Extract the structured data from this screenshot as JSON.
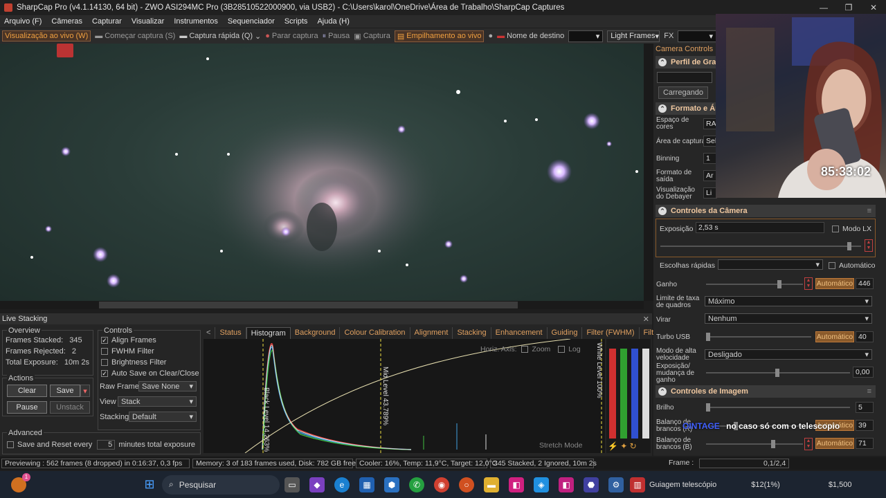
{
  "window": {
    "title": "SharpCap Pro (v4.1.14130, 64 bit) - ZWO ASI294MC Pro (3B28510522000900, via USB2) - C:\\Users\\karol\\OneDrive\\Área de Trabalho\\SharpCap Captures"
  },
  "menu": [
    "Arquivo (F)",
    "Câmeras",
    "Capturar",
    "Visualizar",
    "Instrumentos",
    "Sequenciador",
    "Scripts",
    "Ajuda (H)"
  ],
  "toolbar": {
    "live_view": "Visualização ao vivo (W)",
    "start_capture": "Começar captura (S)",
    "quick_capture": "Captura rápida (Q)",
    "stop_capture": "Parar captura",
    "pause": "Pausa",
    "capture": "Captura",
    "live_stack": "Empilhamento ao vivo",
    "target_label": "Nome de destino",
    "target_value": "",
    "frame_type": "Light Frames",
    "fx_label": "FX",
    "fx_value": ""
  },
  "live_stacking": {
    "title": "Live Stacking",
    "overview": {
      "title": "Overview",
      "frames_stacked_label": "Frames Stacked:",
      "frames_stacked": "345",
      "frames_rejected_label": "Frames Rejected:",
      "frames_rejected": "2",
      "total_exposure_label": "Total Exposure:",
      "total_exposure": "10m 2s"
    },
    "actions": {
      "title": "Actions",
      "clear": "Clear",
      "save": "Save",
      "pause": "Pause",
      "unstack": "Unstack"
    },
    "advanced": {
      "title": "Advanced",
      "save_reset_label": "Save and Reset every",
      "save_reset_value": "5",
      "save_reset_suffix": "minutes total exposure"
    },
    "controls": {
      "title": "Controls",
      "align_frames": "Align Frames",
      "fwhm_filter": "FWHM Filter",
      "brightness_filter": "Brightness Filter",
      "auto_save": "Auto Save on Clear/Close",
      "raw_frames_label": "Raw Frames",
      "raw_frames_value": "Save None",
      "view_label": "View",
      "view_value": "Stack",
      "stacking_label": "Stacking",
      "stacking_value": "Default"
    },
    "tabs": [
      "<",
      "Status",
      "Histogram",
      "Background",
      "Colour Calibration",
      "Alignment",
      "Stacking",
      "Enhancement",
      "Guiding",
      "Filter (FWHM)",
      "Filter (Brightness)",
      "F"
    ],
    "active_tab": "Histogram",
    "histogram": {
      "horiz_axis": "Horiz. Axis:",
      "zoom": "Zoom",
      "log": "Log",
      "black_level": "Black Level 14.263%",
      "mid_level": "Mid Level 43.789%",
      "white_level": "White Level 100%",
      "stretch_mode": "Stretch Mode"
    }
  },
  "status_bar": {
    "previewing": "Previewing : 562 frames (8 dropped) in 0:16:37, 0,3 fps",
    "memory": "Memory: 3 of 183 frames used, Disk: 782 GB free",
    "cooler": "Cooler: 16%, Temp: 11,9°C, Target: 12,0°C",
    "stacked": "345 Stacked, 2 Ignored, 10m 2s",
    "frame_label": "Frame :",
    "frame_value": "0,1/2,4"
  },
  "camera_controls": {
    "title": "Camera Controls",
    "perfil": "Perfil de Grava",
    "carregando": "Carregando",
    "formato": "Formato e Áre",
    "espaco_label": "Espaço de cores",
    "espaco_value": "RA",
    "area_label": "Área de captura",
    "area_value": "Sele",
    "binning_label": "Binning",
    "binning_value": "1",
    "formato_saida_label": "Formato de saída",
    "formato_saida_value": "Ar",
    "debayer_label": "Visualização do Debayer",
    "debayer_value": "Li",
    "controles_camera": "Controles da Câmera",
    "exposicao_label": "Exposição",
    "exposicao_value": "2,53 s",
    "modo_lx": "Modo LX",
    "escolhas_label": "Escolhas rápidas",
    "automatico": "Automático",
    "ganho_label": "Ganho",
    "ganho_value": "446",
    "limite_label": "Limite de taxa de quadros",
    "limite_value": "Máximo",
    "virar_label": "Virar",
    "virar_value": "Nenhum",
    "turbo_label": "Turbo USB",
    "turbo_value": "40",
    "modo_alta_label": "Modo de alta velocidade",
    "modo_alta_value": "Desligado",
    "exposicao_mudanca_label": "Exposição/ mudança de ganho",
    "exposicao_mudanca_value": "0,00",
    "controles_imagem": "Controles de Imagem",
    "brilho_label": "Brilho",
    "brilho_value": "5",
    "balanco_r_label": "Balanço de brancos (R)",
    "balanco_r_value": "39",
    "balanco_b_label": "Balanço de brancos (B)",
    "balanco_b_value": "71"
  },
  "overlay": {
    "timer": "85:33:02",
    "subtitle_name": "OINTAGE",
    "subtitle_text": "no caso só com o telescopio"
  },
  "taskbar": {
    "search": "Pesquisar",
    "app_label": "Guiagem telescópio",
    "ticker1": "$12(1%)",
    "ticker2": "$1,500",
    "badge": "1"
  }
}
